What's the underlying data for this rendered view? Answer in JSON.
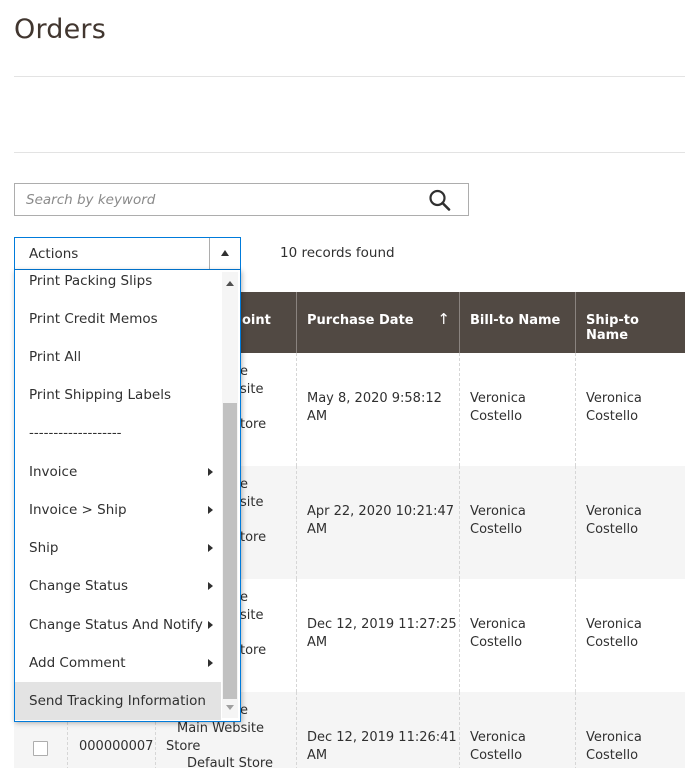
{
  "page": {
    "title": "Orders"
  },
  "search": {
    "placeholder": "Search by keyword",
    "value": ""
  },
  "actions": {
    "label": "Actions"
  },
  "records": {
    "text": "10 records found"
  },
  "menu": {
    "items": [
      {
        "label": "Print Packing Slips",
        "submenu": false
      },
      {
        "label": "Print Credit Memos",
        "submenu": false
      },
      {
        "label": "Print All",
        "submenu": false
      },
      {
        "label": "Print Shipping Labels",
        "submenu": false
      },
      {
        "label": "-------------------",
        "submenu": false
      },
      {
        "label": "Invoice",
        "submenu": true
      },
      {
        "label": "Invoice > Ship",
        "submenu": true
      },
      {
        "label": "Ship",
        "submenu": true
      },
      {
        "label": "Change Status",
        "submenu": true
      },
      {
        "label": "Change Status And Notify",
        "submenu": true
      },
      {
        "label": "Add Comment",
        "submenu": true
      },
      {
        "label": "Send Tracking Information",
        "submenu": false,
        "highlighted": true
      }
    ]
  },
  "grid": {
    "columns": {
      "purchase_point_partial": "oint",
      "purchase_date": "Purchase Date",
      "sort_arrow": "↑",
      "bill_to": "Bill-to Name",
      "ship_to": "Ship-to Name"
    },
    "rows": [
      {
        "store_l1": "e",
        "store_l2": "site",
        "store_l3": "tore",
        "date_l1": "May 8, 2020 9:58:12",
        "date_l2": "AM",
        "bill_l1": "Veronica",
        "bill_l2": "Costello",
        "ship_l1": "Veronica",
        "ship_l2": "Costello"
      },
      {
        "store_l1": "e",
        "store_l2": "site",
        "store_l3": "tore",
        "date_l1": "Apr 22, 2020 10:21:47",
        "date_l2": "AM",
        "bill_l1": "Veronica",
        "bill_l2": "Costello",
        "ship_l1": "Veronica",
        "ship_l2": "Costello"
      },
      {
        "store_l1": "e",
        "store_l2": "site",
        "store_l3": "tore",
        "date_l1": "Dec 12, 2019 11:27:25",
        "date_l2": "AM",
        "bill_l1": "Veronica",
        "bill_l2": "Costello",
        "ship_l1": "Veronica",
        "ship_l2": "Costello"
      },
      {
        "id": "000000007",
        "store_l1": "e",
        "store_l2": "Main Website",
        "store_l3": "Store",
        "store_l4": "Default Store",
        "date_l1": "Dec 12, 2019 11:26:41",
        "date_l2": "AM",
        "bill_l1": "Veronica",
        "bill_l2": "Costello",
        "ship_l1": "Veronica",
        "ship_l2": "Costello"
      }
    ]
  },
  "colors": {
    "accent": "#007bdb",
    "header_bg": "#514943",
    "title": "#41362f"
  },
  "icons": {
    "search": "search-icon"
  }
}
